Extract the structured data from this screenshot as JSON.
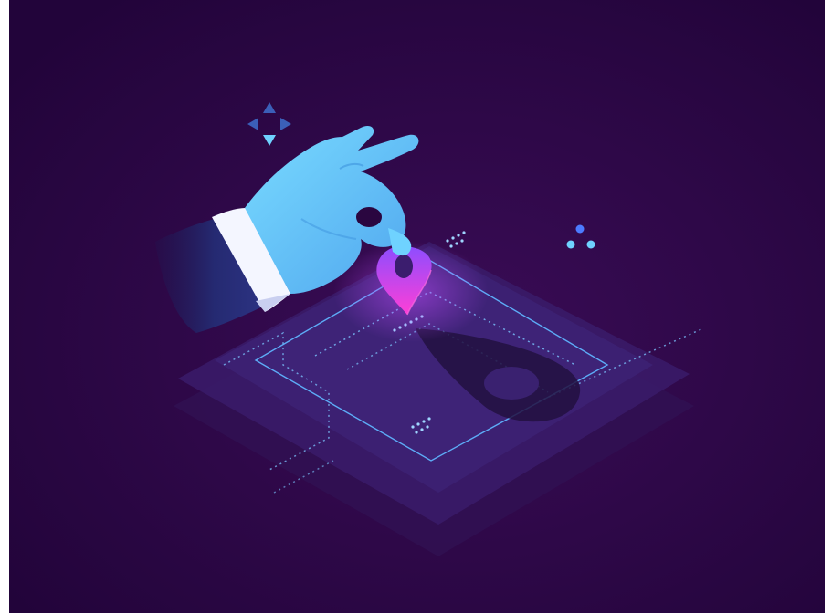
{
  "illustration": {
    "subject": "isometric-map-location-pin-picked-by-hand",
    "colors": {
      "background": "#2a0640",
      "background_edge": "#1e0430",
      "plate_outer": "#3a1a66",
      "plate_inner": "#2f1656",
      "grid_line": "#5fb4ff",
      "pin_top": "#b35cff",
      "pin_bottom": "#ff3fd6",
      "glove": "#6fd2ff",
      "glove_shade": "#4aa6ea",
      "sleeve": "#2a2f78",
      "cuff": "#ffffff",
      "icon": "#6fd2ff",
      "dot_accent": "#4c7bff"
    },
    "icons": [
      "move-arrows-icon",
      "three-dots-icon",
      "location-pin-icon"
    ]
  }
}
